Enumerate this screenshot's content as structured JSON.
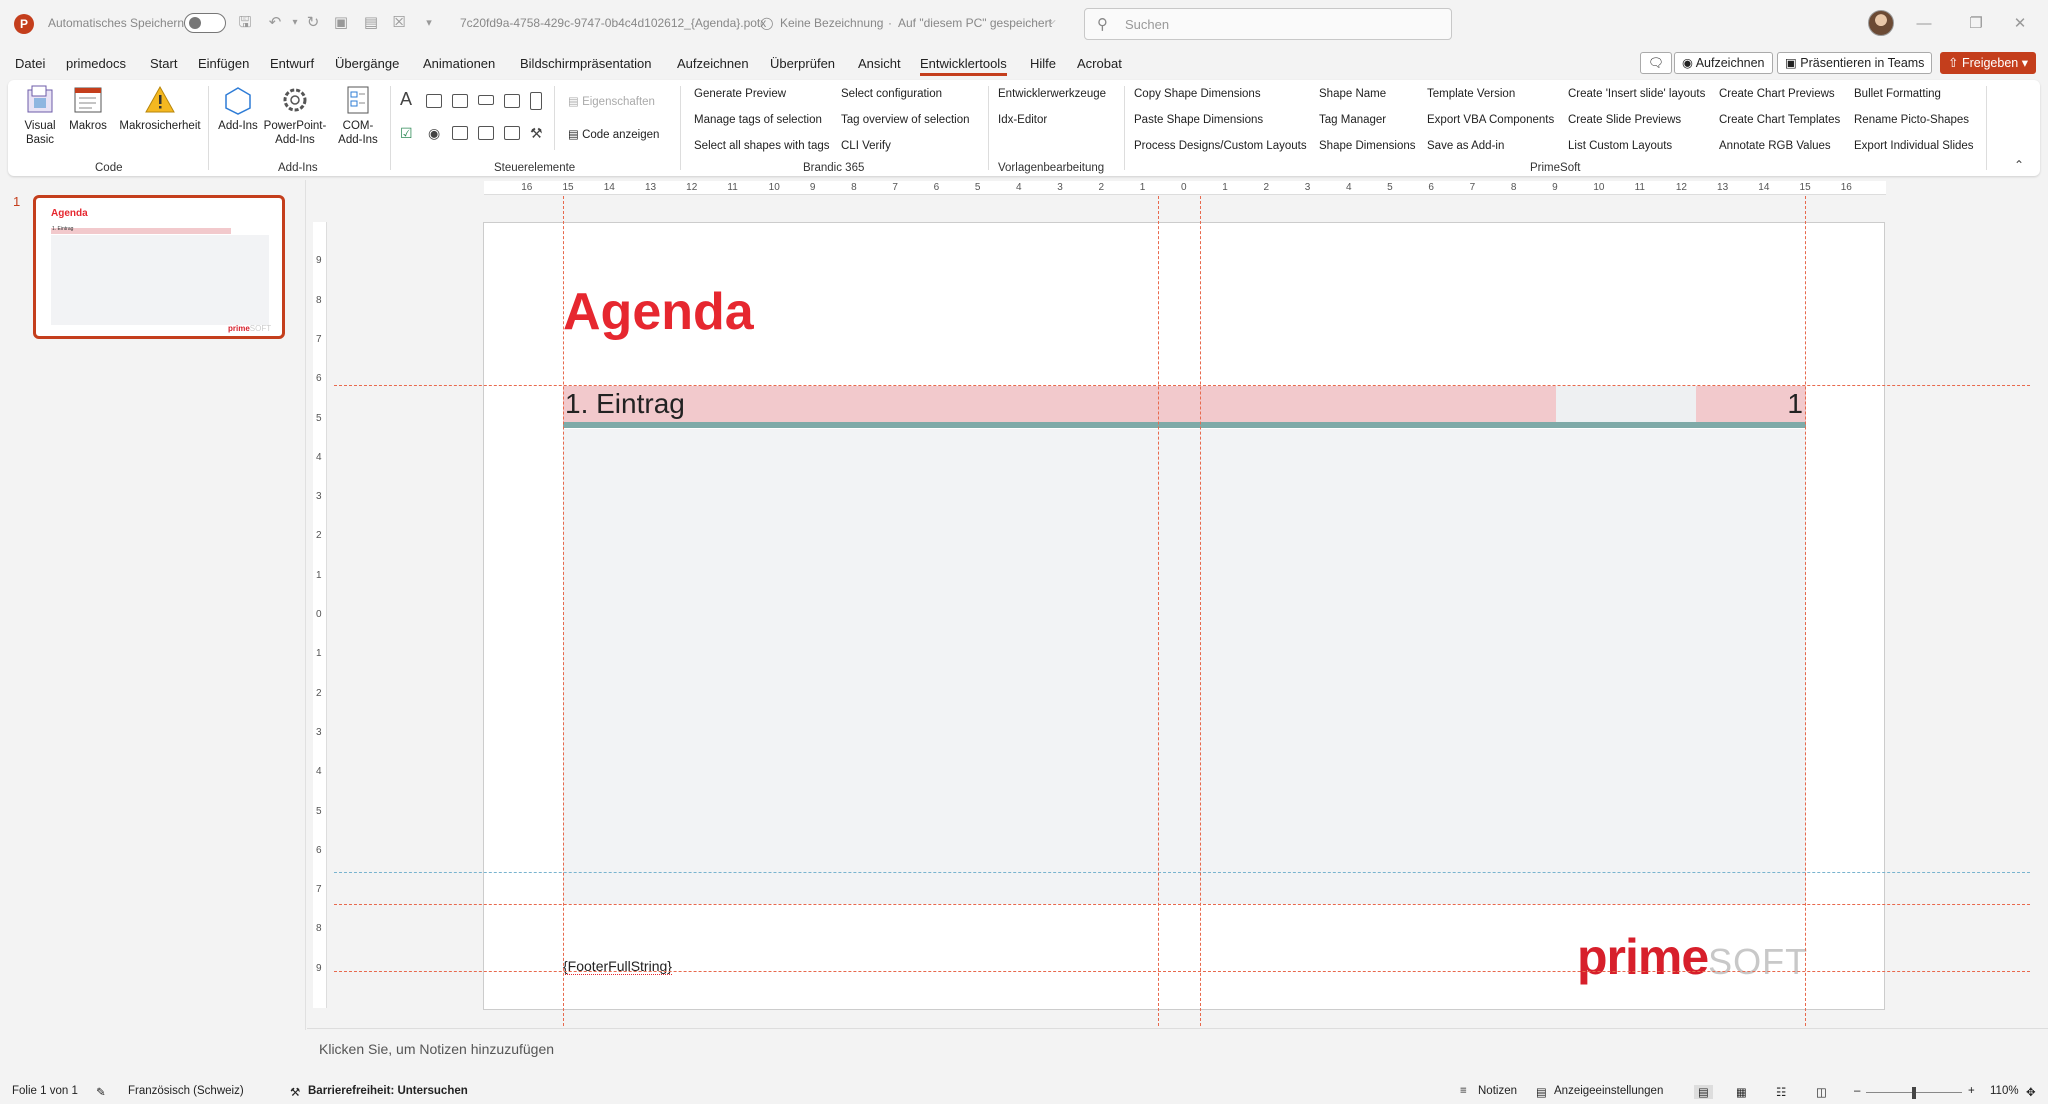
{
  "titlebar": {
    "autosave_label": "Automatisches Speichern",
    "filename": "7c20fd9a-4758-429c-9747-0b4c4d102612_{Agenda}.potx",
    "sensitivity": "Keine Bezeichnung",
    "save_location": "Auf \"diesem PC\" gespeichert",
    "search_placeholder": "Suchen"
  },
  "menu": {
    "tabs": [
      "Datei",
      "primedocs",
      "Start",
      "Einfügen",
      "Entwurf",
      "Übergänge",
      "Animationen",
      "Bildschirmpräsentation",
      "Aufzeichnen",
      "Überprüfen",
      "Ansicht",
      "Entwicklertools",
      "Hilfe",
      "Acrobat"
    ],
    "record_button": "Aufzeichnen",
    "teams_button": "Präsentieren in Teams",
    "share_button": "Freigeben"
  },
  "ribbon": {
    "code": {
      "label": "Code",
      "visual_basic": "Visual Basic",
      "macros": "Makros",
      "macro_security": "Makrosicherheit"
    },
    "addins": {
      "label": "Add-Ins",
      "addins": "Add-Ins",
      "pp_addins": "PowerPoint-Add-Ins",
      "com_addins": "COM-Add-Ins"
    },
    "controls": {
      "label": "Steuerelemente",
      "properties": "Eigenschaften",
      "view_code": "Code anzeigen"
    },
    "brandic": {
      "label": "Brandic 365",
      "col1": [
        "Generate Preview",
        "Manage tags of selection",
        "Select all shapes with tags"
      ],
      "col2": [
        "Select configuration",
        "Tag overview of selection",
        "CLI Verify"
      ]
    },
    "template": {
      "label": "Vorlagenbearbeitung",
      "items": [
        "Entwicklerwerkzeuge",
        "Idx-Editor"
      ]
    },
    "primesoft": {
      "label": "PrimeSoft",
      "col1": [
        "Copy Shape Dimensions",
        "Paste Shape Dimensions",
        "Process Designs/Custom Layouts"
      ],
      "col2": [
        "Shape Name",
        "Tag Manager",
        "Shape Dimensions"
      ],
      "col3": [
        "Template Version",
        "Export VBA Components",
        "Save as Add-in"
      ],
      "col4": [
        "Create 'Insert slide' layouts",
        "Create Slide Previews",
        "List Custom Layouts"
      ],
      "col5": [
        "Create Chart Previews",
        "Create Chart Templates",
        "Annotate RGB Values"
      ],
      "col6": [
        "Bullet Formatting",
        "Rename Picto-Shapes",
        "Export Individual Slides"
      ]
    }
  },
  "thumbnails": {
    "number": "1",
    "title": "Agenda",
    "entry": "1. Eintrag"
  },
  "ruler": {
    "h": [
      "16",
      "15",
      "14",
      "13",
      "12",
      "11",
      "10",
      "9",
      "8",
      "7",
      "6",
      "5",
      "4",
      "3",
      "2",
      "1",
      "0",
      "1",
      "2",
      "3",
      "4",
      "5",
      "6",
      "7",
      "8",
      "9",
      "10",
      "11",
      "12",
      "13",
      "14",
      "15",
      "16"
    ],
    "v": [
      "9",
      "8",
      "7",
      "6",
      "5",
      "4",
      "3",
      "2",
      "1",
      "0",
      "1",
      "2",
      "3",
      "4",
      "5",
      "6",
      "7",
      "8",
      "9"
    ]
  },
  "slide": {
    "title": "Agenda",
    "entry_text": "1. Eintrag",
    "entry_page": "1",
    "footer": "{FooterFullString}",
    "logo_bold": "prime",
    "logo_light": "SOFT"
  },
  "notes": {
    "placeholder": "Klicken Sie, um Notizen hinzuzufügen"
  },
  "status": {
    "slide_count": "Folie 1 von 1",
    "language": "Französisch (Schweiz)",
    "accessibility": "Barrierefreiheit: Untersuchen",
    "notes": "Notizen",
    "display_settings": "Anzeigeeinstellungen",
    "zoom": "110%"
  },
  "colors": {
    "accent": "#c43e1c",
    "title_red": "#e6272f",
    "entry_pink": "#f2c9cc",
    "entry_line": "#7faaa8"
  }
}
